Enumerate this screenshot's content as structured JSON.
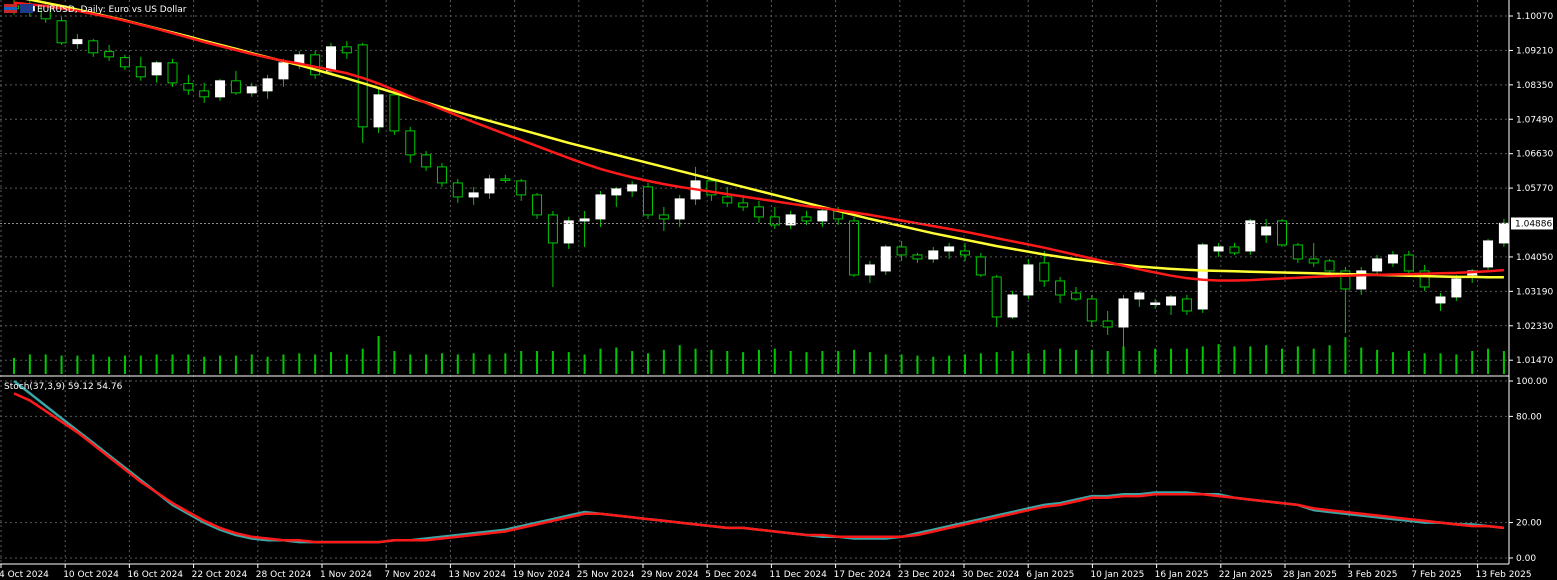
{
  "window": {
    "title": "EURUSD, Daily:  Euro vs US Dollar",
    "subwindow_label": "Stoch(37,3,9) 59.12 54.76",
    "current_price": "1.04886"
  },
  "colors": {
    "background": "#000000",
    "grid": "#5a5a5a",
    "bull_body": "#ffffff",
    "bear_body": "#000000",
    "wick": "#00c800",
    "volume": "#00c800",
    "ma_slow": "#ffff33",
    "ma_fast": "#ff1a1a",
    "stoch_main": "#3aa7a7",
    "stoch_signal": "#ff1a1a",
    "price_line": "#8a8a8a"
  },
  "chart_data": [
    {
      "type": "candlestick",
      "symbol": "EURUSD",
      "timeframe": "Daily",
      "y_axis_ticks": [
        "1.10070",
        "1.09210",
        "1.08350",
        "1.07490",
        "1.06630",
        "1.05770",
        "1.04886",
        "1.04050",
        "1.03190",
        "1.02330",
        "1.01470"
      ],
      "ylim": [
        1.011,
        1.1047
      ],
      "x_axis_labels": [
        "4 Oct 2024",
        "10 Oct 2024",
        "16 Oct 2024",
        "22 Oct 2024",
        "28 Oct 2024",
        "1 Nov 2024",
        "7 Nov 2024",
        "13 Nov 2024",
        "19 Nov 2024",
        "25 Nov 2024",
        "29 Nov 2024",
        "5 Dec 2024",
        "11 Dec 2024",
        "17 Dec 2024",
        "23 Dec 2024",
        "30 Dec 2024",
        "6 Jan 2025",
        "10 Jan 2025",
        "16 Jan 2025",
        "22 Jan 2025",
        "28 Jan 2025",
        "3 Feb 2025",
        "7 Feb 2025",
        "13 Feb 2025"
      ],
      "ohlc": [
        [
          1.1032,
          1.106,
          1.101,
          1.1025
        ],
        [
          1.102,
          1.1045,
          1.1005,
          1.1035
        ],
        [
          1.1032,
          1.104,
          1.099,
          1.1
        ],
        [
          1.0995,
          1.1005,
          1.0935,
          1.094
        ],
        [
          1.0938,
          1.0962,
          1.0925,
          1.0948
        ],
        [
          1.0945,
          1.095,
          1.0905,
          1.0915
        ],
        [
          1.0918,
          1.0935,
          1.0895,
          1.0905
        ],
        [
          1.0903,
          1.091,
          1.0872,
          1.088
        ],
        [
          1.088,
          1.0905,
          1.0845,
          1.0855
        ],
        [
          1.086,
          1.0895,
          1.084,
          1.089
        ],
        [
          1.089,
          1.09,
          1.083,
          1.084
        ],
        [
          1.0838,
          1.086,
          1.081,
          1.0822
        ],
        [
          1.082,
          1.084,
          1.079,
          1.0805
        ],
        [
          1.0805,
          1.085,
          1.0795,
          1.0845
        ],
        [
          1.0845,
          1.087,
          1.081,
          1.0815
        ],
        [
          1.0815,
          1.084,
          1.0805,
          1.083
        ],
        [
          1.082,
          1.086,
          1.08,
          1.085
        ],
        [
          1.085,
          1.09,
          1.083,
          1.089
        ],
        [
          1.089,
          1.092,
          1.0875,
          1.091
        ],
        [
          1.091,
          1.092,
          1.085,
          1.086
        ],
        [
          1.087,
          1.094,
          1.086,
          1.093
        ],
        [
          1.093,
          1.0945,
          1.09,
          1.0915
        ],
        [
          1.0935,
          1.094,
          1.069,
          1.073
        ],
        [
          1.073,
          1.083,
          1.0715,
          1.081
        ],
        [
          1.081,
          1.082,
          1.071,
          1.072
        ],
        [
          1.072,
          1.073,
          1.064,
          1.066
        ],
        [
          1.066,
          1.067,
          1.062,
          1.063
        ],
        [
          1.063,
          1.064,
          1.058,
          1.059
        ],
        [
          1.059,
          1.06,
          1.054,
          1.0555
        ],
        [
          1.0555,
          1.058,
          1.0535,
          1.0565
        ],
        [
          1.0565,
          1.061,
          1.055,
          1.06
        ],
        [
          1.06,
          1.061,
          1.059,
          1.0598
        ],
        [
          1.0595,
          1.06,
          1.0545,
          1.056
        ],
        [
          1.056,
          1.0565,
          1.05,
          1.051
        ],
        [
          1.051,
          1.052,
          1.033,
          1.044
        ],
        [
          1.044,
          1.0505,
          1.0425,
          1.0495
        ],
        [
          1.0495,
          1.052,
          1.043,
          1.05
        ],
        [
          1.05,
          1.057,
          1.048,
          1.056
        ],
        [
          1.056,
          1.058,
          1.053,
          1.0575
        ],
        [
          1.057,
          1.0595,
          1.0555,
          1.0585
        ],
        [
          1.058,
          1.059,
          1.05,
          1.051
        ],
        [
          1.051,
          1.053,
          1.047,
          1.05
        ],
        [
          1.05,
          1.056,
          1.048,
          1.055
        ],
        [
          1.055,
          1.063,
          1.0535,
          1.0595
        ],
        [
          1.0595,
          1.06,
          1.0545,
          1.056
        ],
        [
          1.0555,
          1.058,
          1.053,
          1.054
        ],
        [
          1.054,
          1.056,
          1.052,
          1.053
        ],
        [
          1.053,
          1.0545,
          1.049,
          1.0505
        ],
        [
          1.0505,
          1.053,
          1.0475,
          1.0485
        ],
        [
          1.0485,
          1.052,
          1.0475,
          1.051
        ],
        [
          1.0505,
          1.052,
          1.0485,
          1.0495
        ],
        [
          1.0495,
          1.053,
          1.048,
          1.052
        ],
        [
          1.052,
          1.053,
          1.0485,
          1.05
        ],
        [
          1.0495,
          1.0505,
          1.0355,
          1.036
        ],
        [
          1.036,
          1.0395,
          1.034,
          1.0385
        ],
        [
          1.037,
          1.0435,
          1.036,
          1.043
        ],
        [
          1.043,
          1.0445,
          1.0395,
          1.041
        ],
        [
          1.041,
          1.0415,
          1.039,
          1.04
        ],
        [
          1.04,
          1.043,
          1.039,
          1.042
        ],
        [
          1.042,
          1.044,
          1.04,
          1.043
        ],
        [
          1.042,
          1.044,
          1.0395,
          1.041
        ],
        [
          1.0405,
          1.0415,
          1.0355,
          1.036
        ],
        [
          1.0355,
          1.036,
          1.023,
          1.0255
        ],
        [
          1.0255,
          1.032,
          1.025,
          1.031
        ],
        [
          1.031,
          1.04,
          1.03,
          1.0385
        ],
        [
          1.039,
          1.042,
          1.033,
          1.0345
        ],
        [
          1.0345,
          1.0355,
          1.029,
          1.031
        ],
        [
          1.0315,
          1.033,
          1.0295,
          1.03
        ],
        [
          1.03,
          1.031,
          1.023,
          1.0245
        ],
        [
          1.0245,
          1.027,
          1.021,
          1.023
        ],
        [
          1.023,
          1.031,
          1.018,
          1.03
        ],
        [
          1.03,
          1.032,
          1.028,
          1.0315
        ],
        [
          1.029,
          1.03,
          1.0275,
          1.029
        ],
        [
          1.0285,
          1.031,
          1.026,
          1.0305
        ],
        [
          1.03,
          1.031,
          1.026,
          1.027
        ],
        [
          1.0275,
          1.044,
          1.0265,
          1.0435
        ],
        [
          1.042,
          1.044,
          1.0405,
          1.043
        ],
        [
          1.043,
          1.044,
          1.041,
          1.0415
        ],
        [
          1.042,
          1.05,
          1.041,
          1.0495
        ],
        [
          1.046,
          1.05,
          1.044,
          1.048
        ],
        [
          1.0495,
          1.05,
          1.043,
          1.0435
        ],
        [
          1.0435,
          1.044,
          1.039,
          1.04
        ],
        [
          1.04,
          1.044,
          1.038,
          1.039
        ],
        [
          1.0395,
          1.04,
          1.036,
          1.037
        ],
        [
          1.037,
          1.038,
          1.0215,
          1.0325
        ],
        [
          1.0325,
          1.038,
          1.031,
          1.037
        ],
        [
          1.037,
          1.041,
          1.036,
          1.04
        ],
        [
          1.039,
          1.042,
          1.038,
          1.041
        ],
        [
          1.041,
          1.042,
          1.036,
          1.037
        ],
        [
          1.037,
          1.0385,
          1.032,
          1.033
        ],
        [
          1.029,
          1.0315,
          1.027,
          1.0305
        ],
        [
          1.0305,
          1.036,
          1.0295,
          1.035
        ],
        [
          1.036,
          1.0375,
          1.034,
          1.037
        ],
        [
          1.038,
          1.045,
          1.037,
          1.0445
        ],
        [
          1.044,
          1.05,
          1.043,
          1.0489
        ]
      ],
      "volume": [
        14,
        17,
        17,
        16,
        16,
        17,
        15,
        16,
        16,
        17,
        17,
        17,
        15,
        16,
        16,
        17,
        15,
        17,
        18,
        17,
        19,
        17,
        22,
        33,
        20,
        17,
        17,
        18,
        17,
        18,
        17,
        18,
        20,
        20,
        20,
        19,
        17,
        22,
        23,
        20,
        18,
        21,
        25,
        22,
        21,
        20,
        19,
        21,
        22,
        20,
        19,
        20,
        20,
        21,
        19,
        17,
        17,
        16,
        15,
        16,
        17,
        18,
        19,
        20,
        18,
        21,
        22,
        21,
        21,
        20,
        24,
        20,
        22,
        22,
        22,
        24,
        26,
        24,
        24,
        25,
        22,
        24,
        22,
        25,
        32,
        23,
        21,
        19,
        20,
        18,
        18,
        17,
        20,
        22,
        20
      ],
      "ma_slow": [
        1.1055,
        1.1048,
        1.104,
        1.1032,
        1.1023,
        1.1014,
        1.1005,
        1.0996,
        1.0986,
        1.0976,
        1.0966,
        1.0956,
        1.0945,
        1.0935,
        1.0925,
        1.0914,
        1.0904,
        1.0894,
        1.0884,
        1.0873,
        1.0862,
        1.0851,
        1.0839,
        1.0827,
        1.0815,
        1.0803,
        1.0791,
        1.0779,
        1.0767,
        1.0756,
        1.0745,
        1.0734,
        1.0723,
        1.0712,
        1.0701,
        1.069,
        1.068,
        1.067,
        1.066,
        1.065,
        1.064,
        1.063,
        1.062,
        1.061,
        1.06,
        1.059,
        1.058,
        1.057,
        1.056,
        1.055,
        1.054,
        1.053,
        1.052,
        1.051,
        1.05,
        1.0491,
        1.0482,
        1.0473,
        1.0464,
        1.0456,
        1.0448,
        1.044,
        1.0432,
        1.0425,
        1.0418,
        1.0411,
        1.0405,
        1.0399,
        1.0394,
        1.0389,
        1.0385,
        1.0381,
        1.0378,
        1.0375,
        1.0373,
        1.0371,
        1.037,
        1.0369,
        1.0368,
        1.0367,
        1.0366,
        1.0365,
        1.0364,
        1.0363,
        1.0362,
        1.0361,
        1.036,
        1.0359,
        1.0358,
        1.0357,
        1.0356,
        1.0355,
        1.0355,
        1.0354,
        1.0354
      ],
      "ma_fast": [
        1.104,
        1.1036,
        1.1032,
        1.1026,
        1.102,
        1.1012,
        1.1004,
        1.0995,
        1.0985,
        1.0975,
        1.0964,
        1.0953,
        1.0942,
        1.0932,
        1.0922,
        1.0912,
        1.0903,
        1.0895,
        1.0888,
        1.088,
        1.0872,
        1.0864,
        1.0852,
        1.0838,
        1.0822,
        1.0806,
        1.079,
        1.0774,
        1.0758,
        1.0742,
        1.0727,
        1.0712,
        1.0697,
        1.0682,
        1.0667,
        1.0652,
        1.0638,
        1.0625,
        1.0614,
        1.0604,
        1.0595,
        1.0587,
        1.058,
        1.0574,
        1.0568,
        1.0562,
        1.0556,
        1.055,
        1.0544,
        1.0538,
        1.0532,
        1.0527,
        1.0522,
        1.0516,
        1.051,
        1.0503,
        1.0496,
        1.0489,
        1.0482,
        1.0475,
        1.0468,
        1.046,
        1.0452,
        1.0444,
        1.0436,
        1.0428,
        1.0419,
        1.041,
        1.0401,
        1.0392,
        1.0383,
        1.0374,
        1.0366,
        1.0358,
        1.0352,
        1.0348,
        1.0346,
        1.0346,
        1.0347,
        1.0349,
        1.0351,
        1.0353,
        1.0355,
        1.0357,
        1.0358,
        1.0359,
        1.036,
        1.0361,
        1.0362,
        1.0363,
        1.0364,
        1.0365,
        1.0367,
        1.0369,
        1.0372
      ]
    },
    {
      "type": "line",
      "indicator": "Stoch(37,3,9)",
      "y_axis_ticks": [
        "100.00",
        "80.00",
        "20.00",
        "0.00"
      ],
      "ylim": [
        0,
        100
      ],
      "series": [
        {
          "values": [
            100,
            93,
            86,
            79,
            72,
            65,
            58,
            51,
            44,
            37,
            30,
            25,
            20,
            16,
            13,
            11,
            10,
            10,
            9,
            9,
            9,
            9,
            9,
            9,
            10,
            10,
            11,
            12,
            13,
            14,
            15,
            16,
            18,
            20,
            22,
            24,
            26,
            25,
            24,
            23,
            22,
            21,
            20,
            19,
            18,
            17,
            17,
            16,
            15,
            14,
            13,
            12,
            12,
            11,
            11,
            11,
            12,
            14,
            16,
            18,
            20,
            22,
            24,
            26,
            28,
            30,
            31,
            33,
            35,
            35,
            36,
            36,
            37,
            37,
            37,
            36,
            36,
            34,
            33,
            32,
            31,
            30,
            27,
            26,
            25,
            24,
            23,
            22,
            21,
            20,
            20,
            19,
            19,
            18,
            17
          ]
        },
        {
          "values": [
            93,
            89,
            83,
            77,
            71,
            64,
            57,
            50,
            43,
            37,
            31,
            26,
            21,
            17,
            14,
            12,
            11,
            10,
            10,
            9,
            9,
            9,
            9,
            9,
            10,
            10,
            10,
            11,
            12,
            13,
            14,
            15,
            17,
            19,
            21,
            23,
            25,
            25,
            24,
            23,
            22,
            21,
            20,
            19,
            18,
            17,
            17,
            16,
            15,
            14,
            13,
            13,
            12,
            12,
            12,
            12,
            12,
            13,
            15,
            17,
            19,
            21,
            23,
            25,
            27,
            29,
            30,
            32,
            34,
            34,
            35,
            35,
            36,
            36,
            36,
            36,
            35,
            34,
            33,
            32,
            31,
            30,
            28,
            27,
            26,
            25,
            24,
            23,
            22,
            21,
            20,
            19,
            18,
            18,
            17
          ]
        }
      ]
    }
  ]
}
